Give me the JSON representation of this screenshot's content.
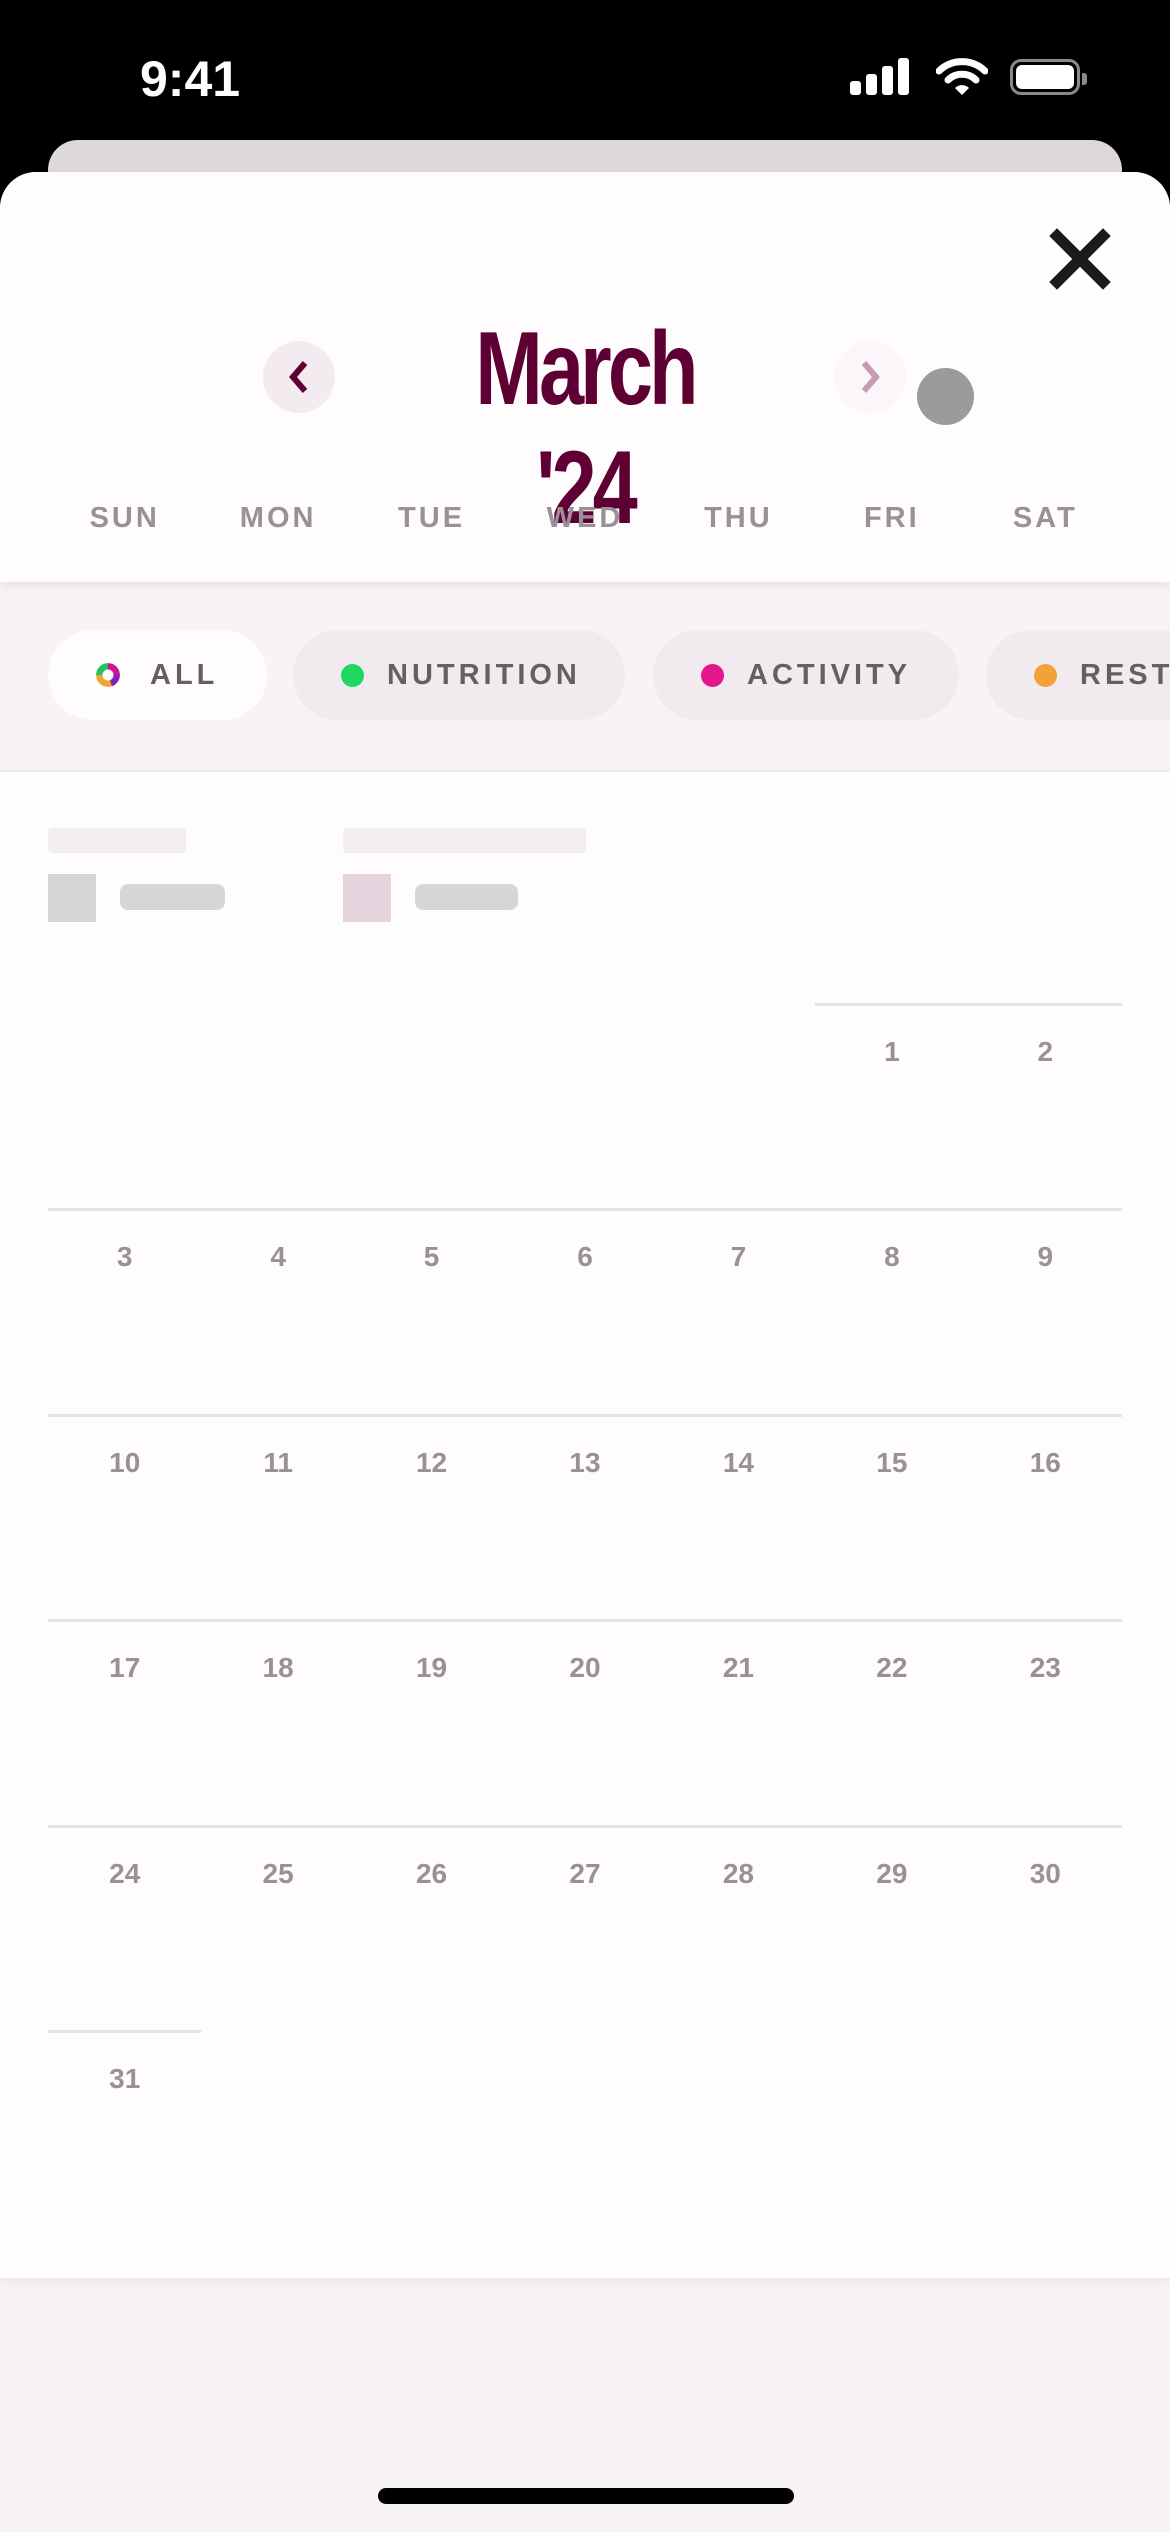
{
  "status_bar": {
    "time": "9:41",
    "icons": [
      "cellular-signal-icon",
      "wifi-icon",
      "battery-icon"
    ]
  },
  "header": {
    "title": "March '24",
    "prev_icon": "chevron-left-icon",
    "next_icon": "chevron-right-icon",
    "close_icon": "close-icon",
    "colors": {
      "title": "#5e0033",
      "prev_chevron": "#5e0033",
      "next_chevron": "#c99ab4"
    }
  },
  "weekdays": [
    "SUN",
    "MON",
    "TUE",
    "WED",
    "THU",
    "FRI",
    "SAT"
  ],
  "filters": [
    {
      "label": "ALL",
      "icon": "multicolor-ring-icon",
      "color": null,
      "active": true
    },
    {
      "label": "NUTRITION",
      "icon": "dot-icon",
      "color": "#1ed760",
      "active": false
    },
    {
      "label": "ACTIVITY",
      "icon": "dot-icon",
      "color": "#e5168c",
      "active": false
    },
    {
      "label": "REST",
      "icon": "dot-icon",
      "color": "#f2a23b",
      "active": false
    }
  ],
  "calendar": {
    "month": "March",
    "year": "2024",
    "first_weekday_index": 5,
    "weeks": [
      [
        null,
        null,
        null,
        null,
        null,
        "1",
        "2"
      ],
      [
        "3",
        "4",
        "5",
        "6",
        "7",
        "8",
        "9"
      ],
      [
        "10",
        "11",
        "12",
        "13",
        "14",
        "15",
        "16"
      ],
      [
        "17",
        "18",
        "19",
        "20",
        "21",
        "22",
        "23"
      ],
      [
        "24",
        "25",
        "26",
        "27",
        "28",
        "29",
        "30"
      ],
      [
        "31",
        null,
        null,
        null,
        null,
        null,
        null
      ]
    ]
  },
  "loading_state": true
}
